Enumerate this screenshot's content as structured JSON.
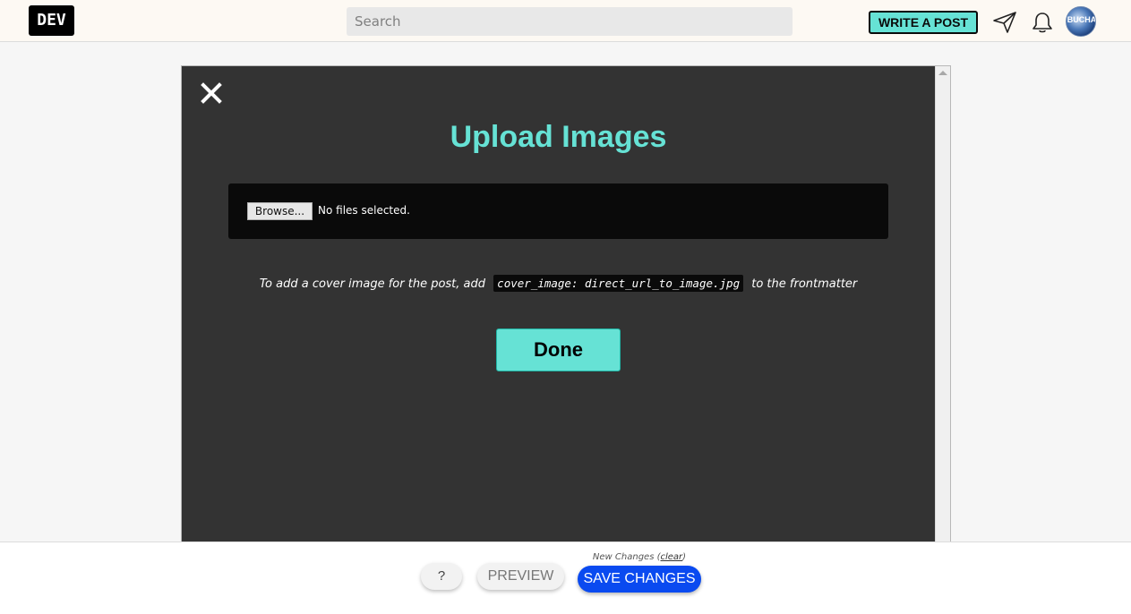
{
  "header": {
    "logo_text": "DEV",
    "search_placeholder": "Search",
    "write_post_label": "WRITE A POST",
    "avatar_label": "BUCHA",
    "icons": [
      "send-icon",
      "bell-icon"
    ]
  },
  "modal": {
    "title": "Upload Images",
    "browse_label": "Browse...",
    "file_status": "No files selected.",
    "hint_before": "To add a cover image for the post, add",
    "hint_code": "cover_image: direct_url_to_image.jpg",
    "hint_after": "to the frontmatter",
    "done_label": "Done",
    "close_icon": "close-icon"
  },
  "footer": {
    "new_changes_prefix": "New Changes (",
    "clear_label": "clear",
    "new_changes_suffix": ")",
    "help_label": "?",
    "preview_label": "PREVIEW",
    "save_label": "SAVE CHANGES"
  },
  "colors": {
    "accent": "#66e2d5",
    "modal_bg": "#333333",
    "save_blue": "#0a4af0",
    "logo_bg": "#000000"
  }
}
